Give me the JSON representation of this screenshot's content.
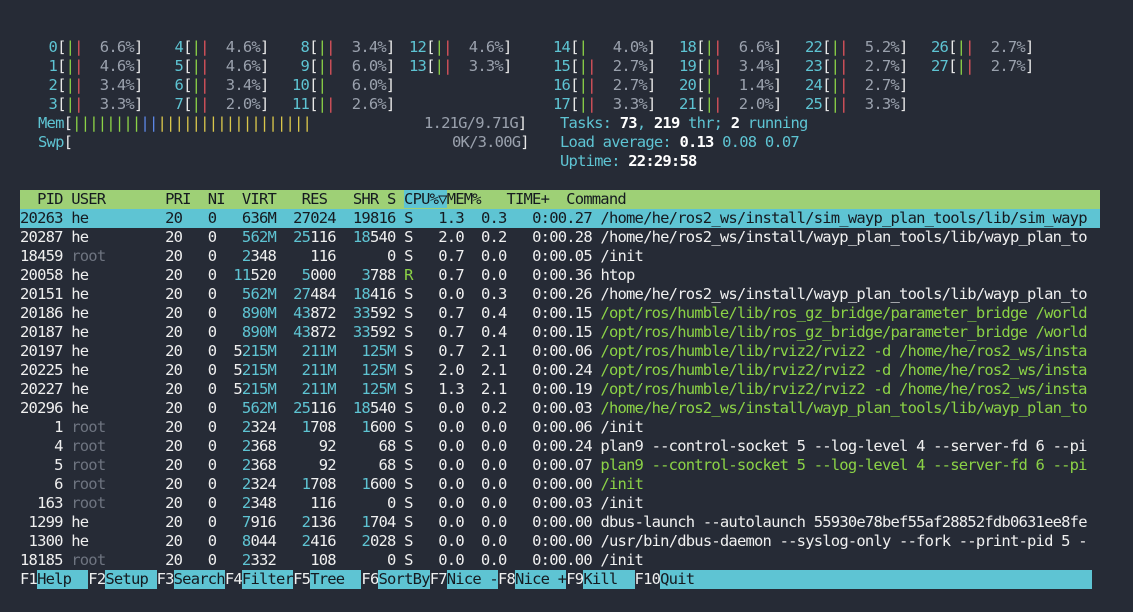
{
  "cpus": [
    {
      "id": "0",
      "pct": "6.6%",
      "bars": "||"
    },
    {
      "id": "1",
      "pct": "4.6%",
      "bars": "||"
    },
    {
      "id": "2",
      "pct": "3.4%",
      "bars": "||"
    },
    {
      "id": "3",
      "pct": "3.3%",
      "bars": "||"
    },
    {
      "id": "4",
      "pct": "4.6%",
      "bars": "||"
    },
    {
      "id": "5",
      "pct": "4.6%",
      "bars": "||"
    },
    {
      "id": "6",
      "pct": "3.4%",
      "bars": "||"
    },
    {
      "id": "7",
      "pct": "2.0%",
      "bars": "||"
    },
    {
      "id": "8",
      "pct": "3.4%",
      "bars": "||"
    },
    {
      "id": "9",
      "pct": "6.0%",
      "bars": "||"
    },
    {
      "id": "10",
      "pct": "6.0%",
      "bars": "|"
    },
    {
      "id": "11",
      "pct": "2.6%",
      "bars": "||"
    },
    {
      "id": "12",
      "pct": "4.6%",
      "bars": "||"
    },
    {
      "id": "13",
      "pct": "3.3%",
      "bars": "||"
    },
    {
      "id": "14",
      "pct": "4.0%",
      "bars": "|"
    },
    {
      "id": "15",
      "pct": "2.7%",
      "bars": "||"
    },
    {
      "id": "16",
      "pct": "2.7%",
      "bars": "||"
    },
    {
      "id": "17",
      "pct": "3.3%",
      "bars": "||"
    },
    {
      "id": "18",
      "pct": "6.6%",
      "bars": "||"
    },
    {
      "id": "19",
      "pct": "3.4%",
      "bars": "||"
    },
    {
      "id": "20",
      "pct": "1.4%",
      "bars": "|"
    },
    {
      "id": "21",
      "pct": "2.0%",
      "bars": "||"
    },
    {
      "id": "22",
      "pct": "5.2%",
      "bars": "||"
    },
    {
      "id": "23",
      "pct": "2.7%",
      "bars": "||"
    },
    {
      "id": "24",
      "pct": "2.7%",
      "bars": "||"
    },
    {
      "id": "25",
      "pct": "3.3%",
      "bars": "||"
    },
    {
      "id": "26",
      "pct": "2.7%",
      "bars": "||"
    },
    {
      "id": "27",
      "pct": "2.7%",
      "bars": "||"
    }
  ],
  "mem": {
    "label": "Mem",
    "green": "||||||||",
    "blue": "||",
    "yellow": "||||||||||||||||||",
    "value": "1.21G/9.71G"
  },
  "swp": {
    "label": "Swp",
    "value": "0K/3.00G"
  },
  "tasks": {
    "label": "Tasks: ",
    "count": "73",
    "sep1": ", ",
    "thr": "219",
    "sep2": " thr; ",
    "running": "2",
    "tail": " running"
  },
  "load": {
    "label": "Load average: ",
    "l1": "0.13",
    "l5": "0.08",
    "l15": "0.07"
  },
  "uptime": {
    "label": "Uptime: ",
    "value": "22:29:58"
  },
  "header": {
    "pid": "  PID",
    "user": " USER     ",
    "pri": "  PRI",
    "ni": "  NI",
    "virt": "  VIRT",
    "res": "   RES",
    "shr": "   SHR",
    "s": " S ",
    "cpu": "CPU%▽",
    "mem": "MEM%",
    "time": "   TIME+ ",
    "cmd": " Command"
  },
  "processes": [
    {
      "pid": "20263",
      "user": "he",
      "pri": "20",
      "ni": "0",
      "virt": "636M",
      "res": "27024",
      "shr": "19816",
      "s": "S",
      "cpu": "1.3",
      "mem": "0.3",
      "time": "0:00.27",
      "cmd": "/home/he/ros2_ws/install/sim_wayp_plan_tools/lib/sim_wayp",
      "selected": true
    },
    {
      "pid": "20287",
      "user": "he",
      "pri": "20",
      "ni": "0",
      "virt": "562M",
      "res": "25116",
      "shr": "18540",
      "s": "S",
      "cpu": "2.0",
      "mem": "0.2",
      "time": "0:00.28",
      "cmd": "/home/he/ros2_ws/install/wayp_plan_tools/lib/wayp_plan_to"
    },
    {
      "pid": "18459",
      "user": "root",
      "pri": "20",
      "ni": "0",
      "virt": "2348",
      "res": "116",
      "shr": "0",
      "s": "S",
      "cpu": "0.7",
      "mem": "0.0",
      "time": "0:00.05",
      "cmd": "/init"
    },
    {
      "pid": "20058",
      "user": "he",
      "pri": "20",
      "ni": "0",
      "virt": "11520",
      "res": "5000",
      "shr": "3788",
      "s": "R",
      "cpu": "0.7",
      "mem": "0.0",
      "time": "0:00.36",
      "cmd": "htop"
    },
    {
      "pid": "20151",
      "user": "he",
      "pri": "20",
      "ni": "0",
      "virt": "562M",
      "res": "27484",
      "shr": "18416",
      "s": "S",
      "cpu": "0.0",
      "mem": "0.3",
      "time": "0:00.26",
      "cmd": "/home/he/ros2_ws/install/wayp_plan_tools/lib/wayp_plan_to"
    },
    {
      "pid": "20186",
      "user": "he",
      "pri": "20",
      "ni": "0",
      "virt": "890M",
      "res": "43872",
      "shr": "33592",
      "s": "S",
      "cpu": "0.7",
      "mem": "0.4",
      "time": "0:00.15",
      "cmd": "/opt/ros/humble/lib/ros_gz_bridge/parameter_bridge /world",
      "thread": true
    },
    {
      "pid": "20187",
      "user": "he",
      "pri": "20",
      "ni": "0",
      "virt": "890M",
      "res": "43872",
      "shr": "33592",
      "s": "S",
      "cpu": "0.7",
      "mem": "0.4",
      "time": "0:00.15",
      "cmd": "/opt/ros/humble/lib/ros_gz_bridge/parameter_bridge /world",
      "thread": true
    },
    {
      "pid": "20197",
      "user": "he",
      "pri": "20",
      "ni": "0",
      "virt": "5215M",
      "res": "211M",
      "shr": "125M",
      "s": "S",
      "cpu": "0.7",
      "mem": "2.1",
      "time": "0:00.06",
      "cmd": "/opt/ros/humble/lib/rviz2/rviz2 -d /home/he/ros2_ws/insta",
      "thread": true
    },
    {
      "pid": "20225",
      "user": "he",
      "pri": "20",
      "ni": "0",
      "virt": "5215M",
      "res": "211M",
      "shr": "125M",
      "s": "S",
      "cpu": "2.0",
      "mem": "2.1",
      "time": "0:00.24",
      "cmd": "/opt/ros/humble/lib/rviz2/rviz2 -d /home/he/ros2_ws/insta",
      "thread": true
    },
    {
      "pid": "20227",
      "user": "he",
      "pri": "20",
      "ni": "0",
      "virt": "5215M",
      "res": "211M",
      "shr": "125M",
      "s": "S",
      "cpu": "1.3",
      "mem": "2.1",
      "time": "0:00.19",
      "cmd": "/opt/ros/humble/lib/rviz2/rviz2 -d /home/he/ros2_ws/insta",
      "thread": true
    },
    {
      "pid": "20296",
      "user": "he",
      "pri": "20",
      "ni": "0",
      "virt": "562M",
      "res": "25116",
      "shr": "18540",
      "s": "S",
      "cpu": "0.0",
      "mem": "0.2",
      "time": "0:00.03",
      "cmd": "/home/he/ros2_ws/install/wayp_plan_tools/lib/wayp_plan_to",
      "thread": true
    },
    {
      "pid": "1",
      "user": "root",
      "pri": "20",
      "ni": "0",
      "virt": "2324",
      "res": "1708",
      "shr": "1600",
      "s": "S",
      "cpu": "0.0",
      "mem": "0.0",
      "time": "0:00.06",
      "cmd": "/init"
    },
    {
      "pid": "4",
      "user": "root",
      "pri": "20",
      "ni": "0",
      "virt": "2368",
      "res": "92",
      "shr": "68",
      "s": "S",
      "cpu": "0.0",
      "mem": "0.0",
      "time": "0:00.24",
      "cmd": "plan9 --control-socket 5 --log-level 4 --server-fd 6 --pi"
    },
    {
      "pid": "5",
      "user": "root",
      "pri": "20",
      "ni": "0",
      "virt": "2368",
      "res": "92",
      "shr": "68",
      "s": "S",
      "cpu": "0.0",
      "mem": "0.0",
      "time": "0:00.07",
      "cmd": "plan9 --control-socket 5 --log-level 4 --server-fd 6 --pi",
      "thread": true
    },
    {
      "pid": "6",
      "user": "root",
      "pri": "20",
      "ni": "0",
      "virt": "2324",
      "res": "1708",
      "shr": "1600",
      "s": "S",
      "cpu": "0.0",
      "mem": "0.0",
      "time": "0:00.00",
      "cmd": "/init",
      "thread": true
    },
    {
      "pid": "163",
      "user": "root",
      "pri": "20",
      "ni": "0",
      "virt": "2348",
      "res": "116",
      "shr": "0",
      "s": "S",
      "cpu": "0.0",
      "mem": "0.0",
      "time": "0:00.03",
      "cmd": "/init"
    },
    {
      "pid": "1299",
      "user": "he",
      "pri": "20",
      "ni": "0",
      "virt": "7916",
      "res": "2136",
      "shr": "1704",
      "s": "S",
      "cpu": "0.0",
      "mem": "0.0",
      "time": "0:00.00",
      "cmd": "dbus-launch --autolaunch 55930e78bef55af28852fdb0631ee8fe"
    },
    {
      "pid": "1300",
      "user": "he",
      "pri": "20",
      "ni": "0",
      "virt": "8044",
      "res": "2416",
      "shr": "2028",
      "s": "S",
      "cpu": "0.0",
      "mem": "0.0",
      "time": "0:00.00",
      "cmd": "/usr/bin/dbus-daemon --syslog-only --fork --print-pid 5 -"
    },
    {
      "pid": "18185",
      "user": "root",
      "pri": "20",
      "ni": "0",
      "virt": "2332",
      "res": "108",
      "shr": "0",
      "s": "S",
      "cpu": "0.0",
      "mem": "0.0",
      "time": "0:00.00",
      "cmd": "/init"
    }
  ],
  "footer": [
    {
      "key": "F1",
      "label": "Help  "
    },
    {
      "key": "F2",
      "label": "Setup "
    },
    {
      "key": "F3",
      "label": "Search"
    },
    {
      "key": "F4",
      "label": "Filter"
    },
    {
      "key": "F5",
      "label": "Tree  "
    },
    {
      "key": "F6",
      "label": "SortBy"
    },
    {
      "key": "F7",
      "label": "Nice -"
    },
    {
      "key": "F8",
      "label": "Nice +"
    },
    {
      "key": "F9",
      "label": "Kill  "
    },
    {
      "key": "F10",
      "label": "Quit"
    }
  ],
  "colors": {
    "bg": "#262b36",
    "cyan": "#5ec4d3",
    "green": "#8bd246",
    "red": "#e0535c",
    "header_bg": "#9ed076"
  }
}
